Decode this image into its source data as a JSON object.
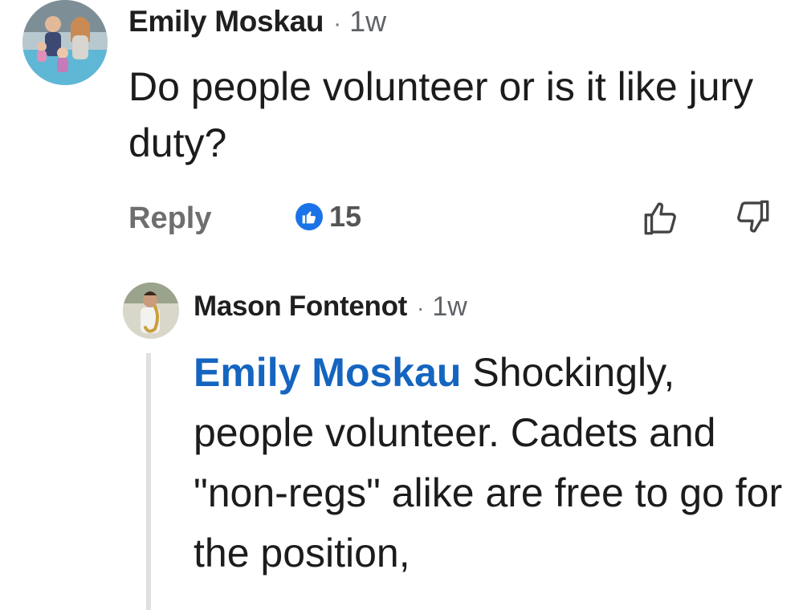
{
  "comment": {
    "author": "Emily Moskau",
    "separator": "·",
    "timestamp": "1w",
    "text": "Do people volunteer or is it like jury duty?",
    "avatar_icon": "profile-photo-family",
    "actions": {
      "reply_label": "Reply",
      "like_count": "15",
      "like_badge_icon": "thumbs-up-icon",
      "like_badge_color": "#1a73e8",
      "thumbs_up_icon": "thumbs-up-outline-icon",
      "thumbs_down_icon": "thumbs-down-outline-icon"
    }
  },
  "reply": {
    "author": "Mason Fontenot",
    "separator": "·",
    "timestamp": "1w",
    "mention": "Emily Moskau",
    "mention_color": "#1565c0",
    "text": " Shockingly, people volunteer. Cadets and \"non-regs\" alike are free to go for the position,",
    "avatar_icon": "profile-photo-saxophone"
  }
}
